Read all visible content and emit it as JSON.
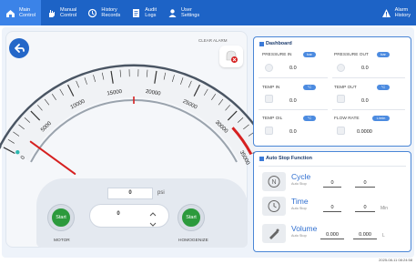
{
  "nav": {
    "items": [
      {
        "label": "Main\nControl",
        "icon": "home-icon"
      },
      {
        "label": "Manual\nControl",
        "icon": "hand-icon"
      },
      {
        "label": "History\nRecords",
        "icon": "history-icon"
      },
      {
        "label": "Audit\nLogs",
        "icon": "document-icon"
      },
      {
        "label": "User\nSettings",
        "icon": "user-icon"
      }
    ],
    "alarm_label": "Alarm\nHistory"
  },
  "gauge": {
    "clear_alarm_label": "CLEAR ALARM",
    "scale_labels": [
      "0",
      "5000",
      "10000",
      "15000",
      "20000",
      "25000",
      "30000",
      "35000"
    ],
    "min": 0,
    "max": 35000,
    "needle_value": 0,
    "psi_value": "0",
    "psi_unit": "psi",
    "stepper_value": "0"
  },
  "controls": {
    "motor_start": "Start",
    "motor_label": "MOTOR",
    "homog_start": "Start",
    "homog_label": "HOMOGENIZE"
  },
  "dashboard": {
    "title": "Dashboard",
    "pressure_in": {
      "label": "PRESSURE IN",
      "unit": "bar",
      "value": "0.0"
    },
    "pressure_out": {
      "label": "PRESSURE OUT",
      "unit": "bar",
      "value": "0.0"
    },
    "temp_in": {
      "label": "TEMP IN",
      "unit": "°C",
      "value": "0.0"
    },
    "temp_out": {
      "label": "TEMP OUT",
      "unit": "°C",
      "value": "0.0"
    },
    "temp_oil": {
      "label": "TEMP OIL",
      "unit": "°C",
      "value": "0.0"
    },
    "flow_rate": {
      "label": "FLOW RATE",
      "unit": "L/min",
      "value": "0.0000"
    }
  },
  "auto_stop": {
    "title": "Auto Stop Function",
    "rows": [
      {
        "name": "Cycle",
        "sub": "Auto Stop",
        "v1": "0",
        "v2": "0",
        "unit": ""
      },
      {
        "name": "Time",
        "sub": "Auto Stop",
        "v1": "0",
        "v2": "0",
        "unit": "Min"
      },
      {
        "name": "Volume",
        "sub": "Auto Stop",
        "v1": "0.000",
        "v2": "0.000",
        "unit": "L"
      }
    ]
  },
  "timestamp": "2025-08-11 08:24:58",
  "colors": {
    "nav_bg": "#1d63c6",
    "accent": "#2f6fd0",
    "start_green": "#2c9a3c",
    "danger_red": "#d62020",
    "gauge_teal": "#2bb8b0"
  }
}
